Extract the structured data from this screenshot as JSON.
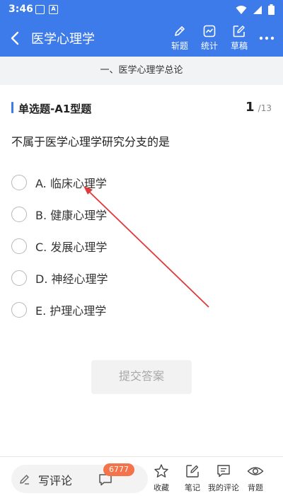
{
  "status_bar": {
    "time": "3:46",
    "notif_a": "A"
  },
  "app_bar": {
    "title": "医学心理学",
    "tools": [
      {
        "label": "斩题",
        "icon": "pen-icon"
      },
      {
        "label": "统计",
        "icon": "chart-icon"
      },
      {
        "label": "草稿",
        "icon": "edit-icon"
      }
    ],
    "more_icon": "more-icon"
  },
  "chapter": "一、医学心理学总论",
  "question_type": "单选题-A1型题",
  "progress": {
    "current": "1",
    "separator": "/",
    "total": "13"
  },
  "question": "不属于医学心理学研究分支的是",
  "options": [
    "A. 临床心理学",
    "B. 健康心理学",
    "C. 发展心理学",
    "D. 神经心理学",
    "E. 护理心理学"
  ],
  "submit_label": "提交答案",
  "bottom": {
    "comment_placeholder": "写评论",
    "comment_count": "6777",
    "actions": [
      {
        "label": "收藏",
        "icon": "star-icon"
      },
      {
        "label": "笔记",
        "icon": "note-icon"
      },
      {
        "label": "我的评论",
        "icon": "comment-icon"
      },
      {
        "label": "背题",
        "icon": "eye-icon"
      }
    ]
  },
  "colors": {
    "primary": "#3d7bea",
    "badge": "#f5734a",
    "annotation": "#e0393b"
  }
}
